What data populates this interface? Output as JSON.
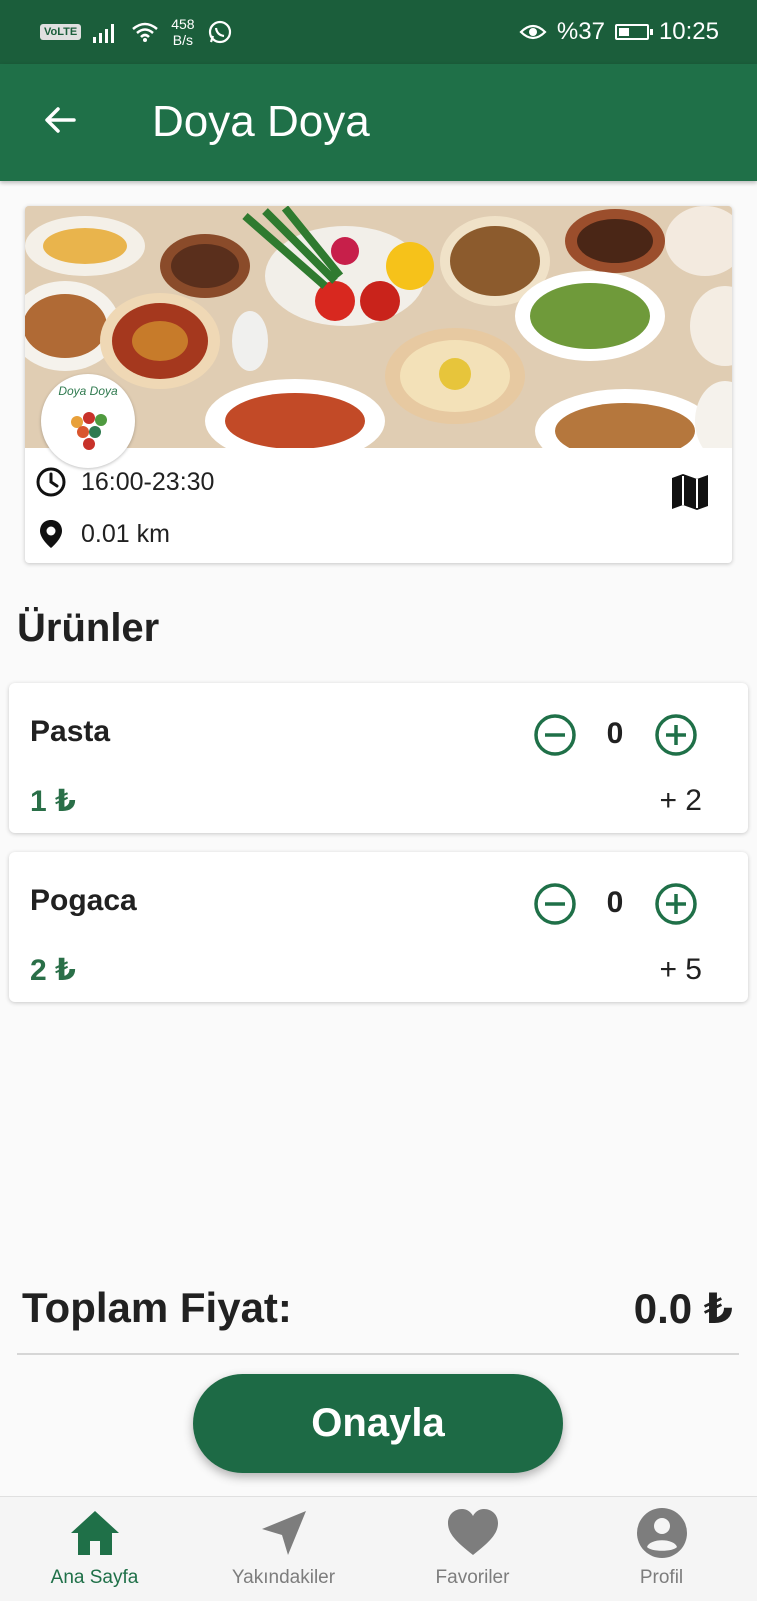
{
  "status_bar": {
    "volte": "VoLTE",
    "net_speed_value": "458",
    "net_speed_unit": "B/s",
    "battery_percent": "%37",
    "battery_level": 0.37,
    "time": "10:25"
  },
  "app_bar": {
    "title": "Doya Doya"
  },
  "restaurant": {
    "logo_text": "Doya Doya",
    "hours": "16:00-23:30",
    "distance": "0.01 km"
  },
  "products_section": {
    "title": "Ürünler"
  },
  "products": [
    {
      "name": "Pasta",
      "price": "1 ₺",
      "quantity": "0",
      "extra": "+ 2"
    },
    {
      "name": "Pogaca",
      "price": "2 ₺",
      "quantity": "0",
      "extra": "+ 5"
    }
  ],
  "total": {
    "label": "Toplam Fiyat:",
    "value": "0.0 ₺"
  },
  "confirm_button": {
    "label": "Onayla"
  },
  "bottom_nav": [
    {
      "label": "Ana Sayfa",
      "icon": "home-icon",
      "active": true
    },
    {
      "label": "Yakındakiler",
      "icon": "navigation-arrow-icon",
      "active": false
    },
    {
      "label": "Favoriler",
      "icon": "heart-icon",
      "active": false
    },
    {
      "label": "Profil",
      "icon": "profile-icon",
      "active": false
    }
  ],
  "colors": {
    "status_bar": "#1b5e3b",
    "app_bar": "#1f7048",
    "accent": "#1d6a45",
    "nav_inactive": "#7d7d7d"
  }
}
